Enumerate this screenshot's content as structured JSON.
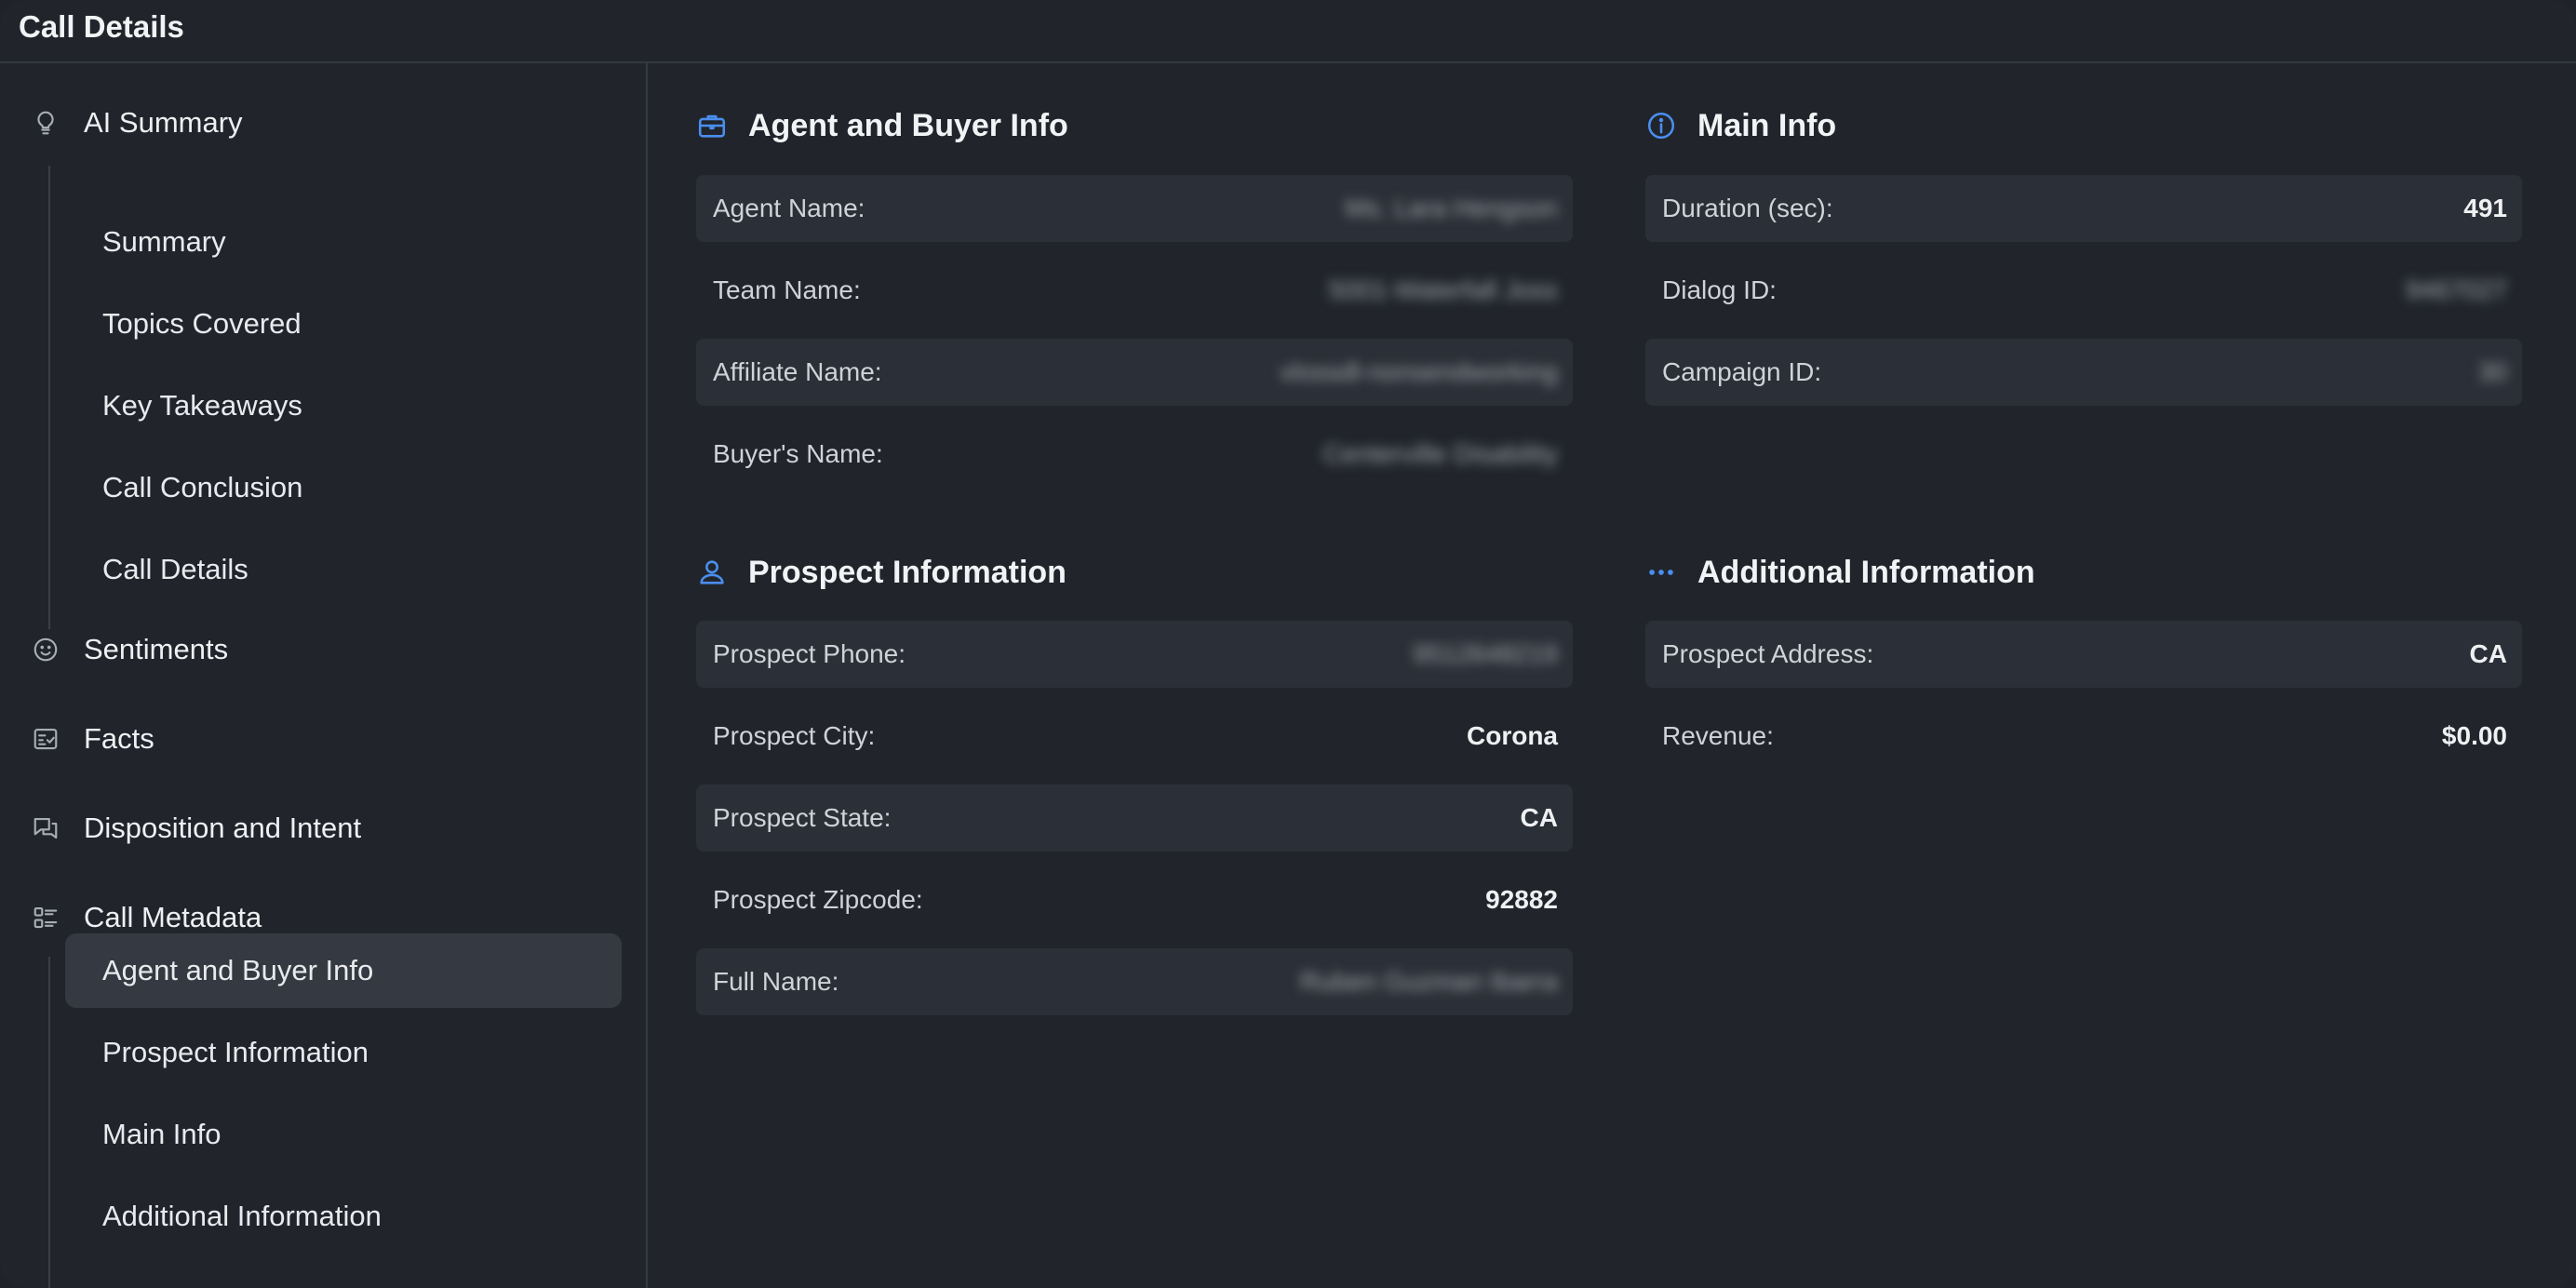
{
  "window": {
    "title": "Call Details"
  },
  "sidebar": {
    "ai_summary": {
      "label": "AI Summary",
      "icon": "lightbulb-icon",
      "children": [
        "Summary",
        "Topics Covered",
        "Key Takeaways",
        "Call Conclusion",
        "Call Details"
      ]
    },
    "sentiments": {
      "label": "Sentiments",
      "icon": "smiley-icon"
    },
    "facts": {
      "label": "Facts",
      "icon": "fact-card-icon"
    },
    "disposition": {
      "label": "Disposition and Intent",
      "icon": "chat-bubbles-icon"
    },
    "call_metadata": {
      "label": "Call Metadata",
      "icon": "list-icon",
      "children": [
        "Agent and Buyer Info",
        "Prospect Information",
        "Main Info",
        "Additional Information"
      ],
      "active": "Agent and Buyer Info"
    }
  },
  "sections": {
    "agent_buyer": {
      "title": "Agent and Buyer Info",
      "icon": "briefcase-icon",
      "rows": [
        {
          "label": "Agent Name:",
          "value": "Ms. Lara Hengson",
          "redacted": true
        },
        {
          "label": "Team Name:",
          "value": "5001-Waterfall Joss",
          "redacted": true
        },
        {
          "label": "Affiliate Name:",
          "value": "vlossdl-nonsendworking",
          "redacted": true
        },
        {
          "label": "Buyer's Name:",
          "value": "Centerville Disability",
          "redacted": true
        }
      ]
    },
    "main_info": {
      "title": "Main Info",
      "icon": "info-circle-icon",
      "rows": [
        {
          "label": "Duration (sec):",
          "value": "491"
        },
        {
          "label": "Dialog ID:",
          "value": "9467027",
          "redacted": true
        },
        {
          "label": "Campaign ID:",
          "value": "30",
          "redacted": true
        }
      ]
    },
    "prospect": {
      "title": "Prospect Information",
      "icon": "person-icon",
      "rows": [
        {
          "label": "Prospect Phone:",
          "value": "9512648219",
          "redacted": true
        },
        {
          "label": "Prospect City:",
          "value": "Corona"
        },
        {
          "label": "Prospect State:",
          "value": "CA"
        },
        {
          "label": "Prospect Zipcode:",
          "value": "92882"
        },
        {
          "label": "Full Name:",
          "value": "Ruben Guzman Ibarra",
          "redacted": true
        }
      ]
    },
    "additional": {
      "title": "Additional Information",
      "icon": "more-dots-icon",
      "rows": [
        {
          "label": "Prospect Address:",
          "value": "CA"
        },
        {
          "label": "Revenue:",
          "value": "$0.00"
        }
      ]
    }
  },
  "colors": {
    "accent": "#4a8ef0",
    "background": "#21252b",
    "row_shaded": "#2b2f37",
    "active_nav": "#353a42"
  }
}
